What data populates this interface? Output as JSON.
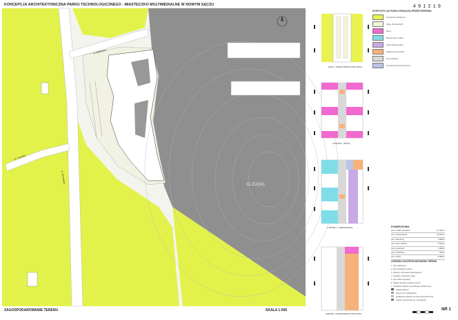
{
  "board": {
    "title": "KONCEPCJA ARCHITEKTONICZNA PARKU TECHNOLOGICZNEGO - MIASTECZKO MULTIMEDIALNE W NOWYM SĄCZU",
    "number": "491219",
    "footer_left": "ZAGOSPODAROWANIE TERENU",
    "scale": "SKALA 1:500",
    "sheet": "NR 1"
  },
  "site_plan": {
    "zone_code": "11.ZU(24)",
    "streets": [
      "ul. Myśliwska",
      "ul. Lwowska",
      "ul. Tarnowska"
    ],
    "colors": {
      "green_area": "#e2f24a",
      "slope": "#8f8f8f",
      "building": "#ffffff",
      "ground": "#f4f4ef"
    }
  },
  "legend": {
    "title": "DYSPOZYCJA FUNKCJONALNO-PRZESTRZENNA",
    "items": [
      {
        "label": "przestrzeń publiczna",
        "color": "#e9f250"
      },
      {
        "label": "trawy dla pieszych",
        "color": "#f4f4dc"
      },
      {
        "label": "biura",
        "color": "#f06ad0"
      },
      {
        "label": "laboratoria i studia",
        "color": "#7fdde8"
      },
      {
        "label": "sale konferencyjne",
        "color": "#c9a8e6"
      },
      {
        "label": "funkcje pomocnicze",
        "color": "#f7b27a"
      },
      {
        "label": "komunikacja",
        "color": "#d8d8d8"
      },
      {
        "label": "pomieszczenia techniczne",
        "color": "#b9c4e8"
      }
    ]
  },
  "panels": {
    "roof": "DACH - PRZESTRZEŃ PUBLICZNA",
    "floor3": "3 PIĘTRO - BIURA",
    "floor1": "1 PIĘTRO - LABORATORIA",
    "ground": "PARTER - PRZESTRZEŃ PUBLICZNA"
  },
  "parameters": {
    "title": "POWIERZCHNIA",
    "rows": [
      {
        "label": "pow. działki (ZU4/Z/H)",
        "value": "20 450m²"
      },
      {
        "label": "teren opracowania",
        "value": "19 467m²"
      },
      {
        "label": "pow. zabudowy",
        "value": "2 855m²"
      },
      {
        "label": "pow. dróg i placów",
        "value": "2 610m²"
      },
      {
        "label": "pow. parkingów",
        "value": "1 880m²"
      },
      {
        "label": "pow. chodników",
        "value": "596m²"
      },
      {
        "label": "pow. zieleni",
        "value": "8 955m²"
      }
    ]
  },
  "plan_legend": {
    "title": "LEGENDA ZAGOSPODAROWANIA TERENU",
    "items": [
      "1. plac wejściowy",
      "2. plac dostawczy pieszo",
      "3. parking - 90 miejsc parkingowych",
      "4. możliwe rozbudowy drogi",
      "5. pas zieleni wysokiej",
      "6. dojazd do placu dostaw i pieszo",
      "7. możliwość wjazdu do parkingu podziemnego",
      "wejście główne",
      "wjazd od ul. Myśliwskiej",
      "dodatkowe wjazdy od innej drogi pobocznej",
      "miejsce wykonania opt. wizualizacji"
    ]
  }
}
